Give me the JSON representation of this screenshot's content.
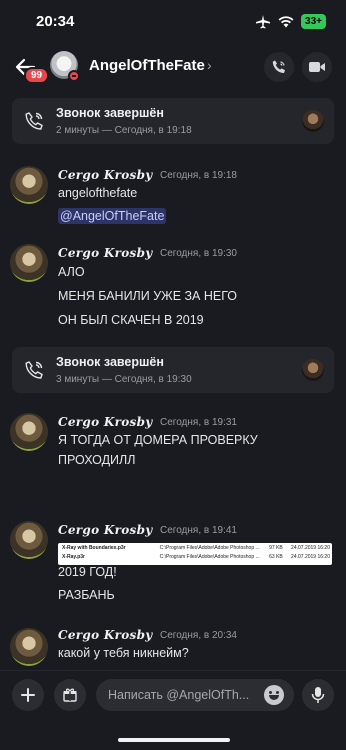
{
  "status": {
    "time": "20:34",
    "battery": "33+"
  },
  "header": {
    "unread_count": "99",
    "name": "AngelOfTheFate",
    "chevron": "›"
  },
  "calls": [
    {
      "title": "Звонок завершён",
      "subtitle": "2 минуты — Сегодня, в 19:18"
    },
    {
      "title": "Звонок завершён",
      "subtitle": "3 минуты — Сегодня, в 19:30"
    }
  ],
  "messages": [
    {
      "author": "Cergo Krosby",
      "time": "Сегодня, в 19:18",
      "lines": [
        "angelofthefate"
      ],
      "mention": "@AngelOfTheFate"
    },
    {
      "author": "Cergo Krosby",
      "time": "Сегодня, в 19:30",
      "lines": [
        "АЛО",
        "МЕНЯ БАНИЛИ УЖЕ ЗА НЕГО",
        "ОН БЫЛ СКАЧЕН В 2019"
      ]
    },
    {
      "author": "Cergo Krosby",
      "time": "Сегодня, в 19:31",
      "lines": [
        "Я ТОГДА ОТ ДОМЕРА ПРОВЕРКУ",
        "ПРОХОДИЛЛ"
      ]
    },
    {
      "author": "Cergo Krosby",
      "time": "Сегодня, в 19:41",
      "lines": [
        "2019 ГОД!",
        "РАЗБАНЬ"
      ]
    },
    {
      "author": "Cergo Krosby",
      "time": "Сегодня, в 20:34",
      "lines": [
        "какой у тебя никнейм?"
      ]
    }
  ],
  "file_rows": [
    {
      "name": "X-Ray with Boundaries.p3r",
      "path": "C:\\Program Files\\Adobe\\Adobe Photoshop ...",
      "size": "97 KB",
      "date": "24.07.2019 16:20"
    },
    {
      "name": "X-Ray.p3r",
      "path": "C:\\Program Files\\Adobe\\Adobe Photoshop ...",
      "size": "63 KB",
      "date": "24.07.2019 16:20"
    }
  ],
  "composer": {
    "placeholder": "Написать @AngelOfTh..."
  },
  "colors": {
    "background": "#1a1b20",
    "card": "#25262c",
    "mention": "#5865f2",
    "dnd": "#e5484d",
    "battery": "#34c759"
  }
}
